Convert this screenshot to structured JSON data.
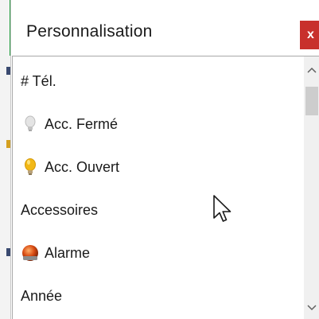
{
  "dialog": {
    "title": "Personnalisation",
    "close_label": "x"
  },
  "list": {
    "items": [
      {
        "label": "# Tél.",
        "icon": ""
      },
      {
        "label": "Acc. Fermé",
        "icon": "bulb-off-icon"
      },
      {
        "label": "Acc. Ouvert",
        "icon": "bulb-on-icon"
      },
      {
        "label": "Accessoires",
        "icon": ""
      },
      {
        "label": "Alarme",
        "icon": "alarm-light-icon"
      },
      {
        "label": "Année",
        "icon": ""
      }
    ]
  },
  "colors": {
    "close_button": "#c8302c",
    "bulb_on": "#f2b816",
    "alarm": "#d84b12"
  },
  "icons": {
    "scroll_up": "chevron-up-icon",
    "scroll_down": "chevron-down-icon",
    "cursor": "mouse-pointer-icon"
  }
}
